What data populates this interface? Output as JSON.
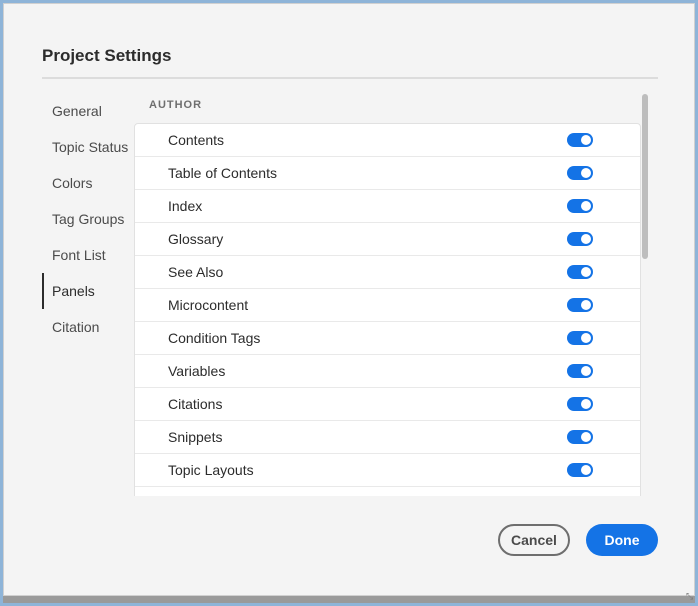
{
  "dialog": {
    "title": "Project Settings",
    "section_label": "AUTHOR"
  },
  "sidebar": {
    "items": [
      {
        "label": "General",
        "active": false
      },
      {
        "label": "Topic Status",
        "active": false
      },
      {
        "label": "Colors",
        "active": false
      },
      {
        "label": "Tag Groups",
        "active": false
      },
      {
        "label": "Font List",
        "active": false
      },
      {
        "label": "Panels",
        "active": true
      },
      {
        "label": "Citation",
        "active": false
      }
    ]
  },
  "panels": [
    {
      "label": "Contents",
      "enabled": true
    },
    {
      "label": "Table of Contents",
      "enabled": true
    },
    {
      "label": "Index",
      "enabled": true
    },
    {
      "label": "Glossary",
      "enabled": true
    },
    {
      "label": "See Also",
      "enabled": true
    },
    {
      "label": "Microcontent",
      "enabled": true
    },
    {
      "label": "Condition Tags",
      "enabled": true
    },
    {
      "label": "Variables",
      "enabled": true
    },
    {
      "label": "Citations",
      "enabled": true
    },
    {
      "label": "Snippets",
      "enabled": true
    },
    {
      "label": "Topic Layouts",
      "enabled": true
    },
    {
      "label": "",
      "enabled": true
    }
  ],
  "footer": {
    "cancel_label": "Cancel",
    "done_label": "Done"
  },
  "colors": {
    "accent": "#1473e6",
    "background": "#f4f4f4"
  }
}
